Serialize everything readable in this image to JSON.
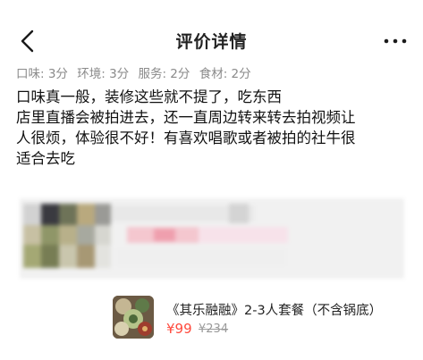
{
  "header": {
    "title": "评价详情",
    "back_icon": "back-chevron-icon",
    "more_icon": "more-dots-icon"
  },
  "ratings": [
    {
      "label": "口味: 3分"
    },
    {
      "label": "环境: 3分"
    },
    {
      "label": "服务: 2分"
    },
    {
      "label": "食材: 2分"
    }
  ],
  "review": {
    "lines": [
      "口味真一般，装修这些就不提了，吃东西",
      "店里直播会被拍进去，还一直周边转来转去拍视频让",
      "人很烦，体验很不好！有喜欢唱歌或者被拍的社牛很",
      "适合去吃"
    ]
  },
  "product": {
    "name": "《其乐融融》2-3人套餐（不含锅底）",
    "price": "¥99",
    "original_price": "¥234",
    "price_color": "#ff4a3d"
  },
  "colors": {
    "text_primary": "#111111",
    "text_secondary": "#8a8a8a",
    "price": "#ff4a3d"
  }
}
